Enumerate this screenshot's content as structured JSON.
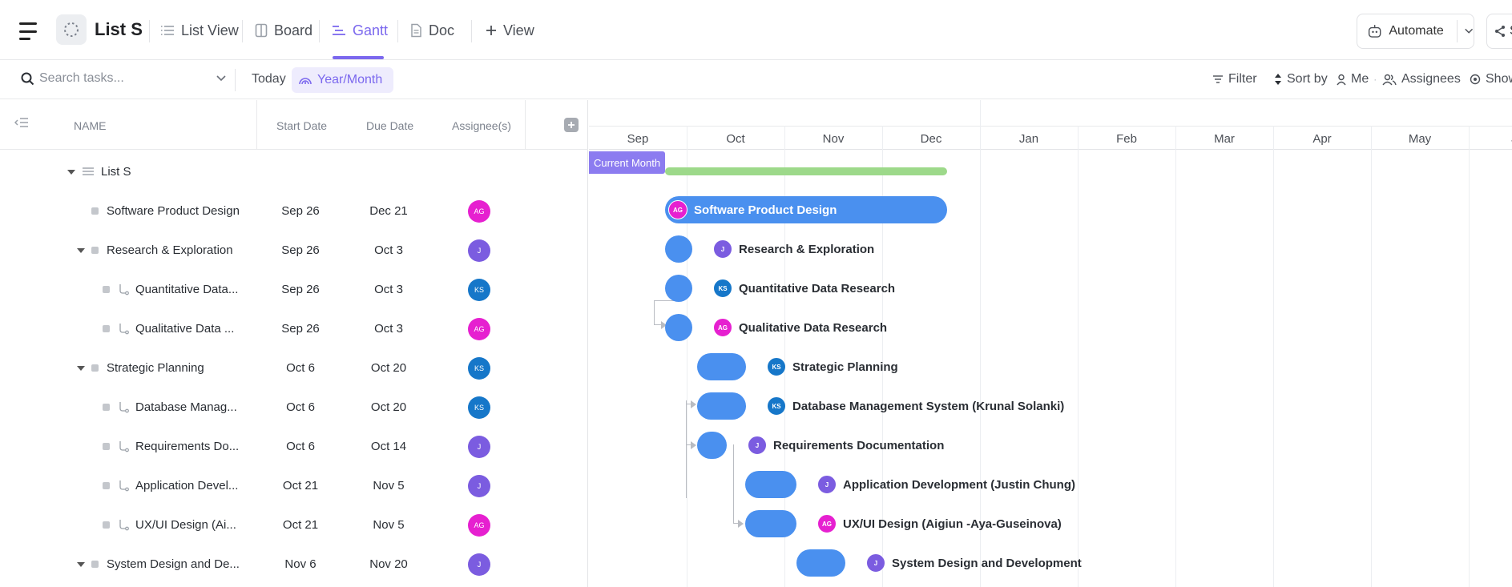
{
  "header": {
    "list_name": "List S",
    "views": [
      {
        "label": "List View",
        "icon": "list-icon"
      },
      {
        "label": "Board",
        "icon": "board-icon"
      },
      {
        "label": "Gantt",
        "icon": "gantt-icon",
        "active": true
      },
      {
        "label": "Doc",
        "icon": "doc-icon"
      },
      {
        "label": "View",
        "icon": "plus-icon"
      }
    ],
    "automate_label": "Automate",
    "share_label": "S"
  },
  "toolbar": {
    "search_placeholder": "Search tasks...",
    "today_label": "Today",
    "yearmonth_label": "Year/Month",
    "filter_label": "Filter",
    "sortby_label": "Sort by",
    "me_label": "Me",
    "assignees_label": "Assignees",
    "show_label": "Show"
  },
  "table": {
    "columns": {
      "name": "NAME",
      "start": "Start Date",
      "due": "Due Date",
      "assignee": "Assignee(s)"
    },
    "group_label": "List S",
    "rows": [
      {
        "name": "Software Product Design",
        "start": "Sep 26",
        "due": "Dec 21",
        "assignee": "AG"
      },
      {
        "name": "Research & Exploration",
        "start": "Sep 26",
        "due": "Oct 3",
        "assignee": "J"
      },
      {
        "name": "Quantitative Data...",
        "start": "Sep 26",
        "due": "Oct 3",
        "assignee": "KS"
      },
      {
        "name": "Qualitative Data ...",
        "start": "Sep 26",
        "due": "Oct 3",
        "assignee": "AG"
      },
      {
        "name": "Strategic Planning",
        "start": "Oct 6",
        "due": "Oct 20",
        "assignee": "KS"
      },
      {
        "name": "Database Manag...",
        "start": "Oct 6",
        "due": "Oct 20",
        "assignee": "KS"
      },
      {
        "name": "Requirements Do...",
        "start": "Oct 6",
        "due": "Oct 14",
        "assignee": "J"
      },
      {
        "name": "Application Devel...",
        "start": "Oct 21",
        "due": "Nov 5",
        "assignee": "J"
      },
      {
        "name": "UX/UI Design (Ai...",
        "start": "Oct 21",
        "due": "Nov 5",
        "assignee": "AG"
      },
      {
        "name": "System Design and De...",
        "start": "Nov 6",
        "due": "Nov 20",
        "assignee": "J"
      }
    ]
  },
  "gantt": {
    "months": [
      "Sep",
      "Oct",
      "Nov",
      "Dec",
      "Jan",
      "Feb",
      "Mar",
      "Apr",
      "May",
      "Ju"
    ],
    "current_month_label": "Current Month",
    "bars": [
      {
        "label": "Software Product Design",
        "assignee": "AG"
      },
      {
        "label": "Research & Exploration",
        "assignee": "J"
      },
      {
        "label": "Quantitative Data Research",
        "assignee": "KS"
      },
      {
        "label": "Qualitative Data Research",
        "assignee": "AG"
      },
      {
        "label": "Strategic Planning",
        "assignee": "KS"
      },
      {
        "label": "Database Management System (Krunal Solanki)",
        "assignee": "KS"
      },
      {
        "label": "Requirements Documentation",
        "assignee": "J"
      },
      {
        "label": "Application Development (Justin Chung)",
        "assignee": "J"
      },
      {
        "label": "UX/UI Design (Aigiun -Aya-Guseinova)",
        "assignee": "AG"
      },
      {
        "label": "System Design and Development",
        "assignee": "J"
      }
    ]
  },
  "colors": {
    "accent": "#7b68ee",
    "bar": "#4a90ef",
    "summary": "#9dd98a",
    "avatar_AG": "#e620d0",
    "avatar_J": "#7b5ce0",
    "avatar_KS": "#1677c9"
  }
}
